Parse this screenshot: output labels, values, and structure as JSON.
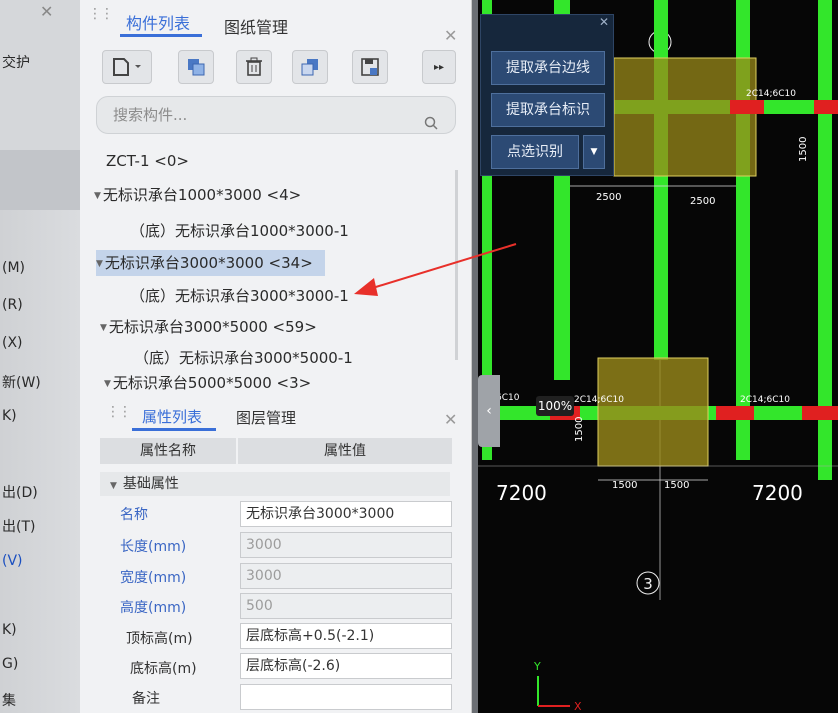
{
  "left_menu": {
    "items": [
      "交护",
      "(M)",
      "(R)",
      "(X)",
      "新(W)",
      "K)",
      "出(D)",
      "出(T)",
      "(V)",
      "K)",
      "G)",
      "集"
    ]
  },
  "component_panel": {
    "tabs": [
      "构件列表",
      "图纸管理"
    ],
    "search_placeholder": "搜索构件...",
    "tree": [
      {
        "label": "ZCT-1  <0>",
        "level": 0,
        "expander": false
      },
      {
        "label": "无标识承台1000*3000  <4>",
        "level": 0,
        "expander": true
      },
      {
        "label": "（底）无标识承台1000*3000-1",
        "level": 1,
        "expander": false
      },
      {
        "label": "无标识承台3000*3000  <34>",
        "level": 0,
        "expander": true,
        "selected": true
      },
      {
        "label": "（底）无标识承台3000*3000-1",
        "level": 1,
        "expander": false
      },
      {
        "label": "无标识承台3000*5000  <59>",
        "level": 0,
        "expander": true
      },
      {
        "label": "（底）无标识承台3000*5000-1",
        "level": 1,
        "expander": false
      },
      {
        "label": "无标识承台5000*5000  <3>",
        "level": 0,
        "expander": true
      }
    ]
  },
  "property_panel": {
    "tabs": [
      "属性列表",
      "图层管理"
    ],
    "headers": [
      "属性名称",
      "属性值"
    ],
    "group": "基础属性",
    "rows": [
      {
        "name": "名称",
        "value": "无标识承台3000*3000",
        "editable": true
      },
      {
        "name": "长度(mm)",
        "value": "3000",
        "editable": false
      },
      {
        "name": "宽度(mm)",
        "value": "3000",
        "editable": false
      },
      {
        "name": "高度(mm)",
        "value": "500",
        "editable": false
      },
      {
        "name": "顶标高(m)",
        "value": "层底标高+0.5(-2.1)",
        "editable": true
      },
      {
        "name": "底标高(m)",
        "value": "层底标高(-2.6)",
        "editable": true
      },
      {
        "name": "备注",
        "value": "",
        "editable": true
      }
    ]
  },
  "float_toolbar": {
    "buttons": [
      "提取承台边线",
      "提取承台标识",
      "点选识别"
    ]
  },
  "cad": {
    "zoom": "100%",
    "axis_top": "3",
    "axis_bottom": "3",
    "dims": [
      "2500",
      "2500",
      "1500",
      "1500",
      "1500",
      "1500"
    ],
    "spans": [
      "7200",
      "7200"
    ],
    "beam_labels": [
      "2C14;6C10",
      "2C14;6C10",
      "2C14;6C10",
      "6C10",
      "2C14;6C10"
    ],
    "axes_labels": [
      "Y",
      "X"
    ]
  },
  "colors": {
    "accent": "#3a6fd8",
    "cad_bg": "#060606",
    "beam": "#33e62b",
    "cap": "#9a8a1a",
    "arrow": "#e8302a"
  }
}
